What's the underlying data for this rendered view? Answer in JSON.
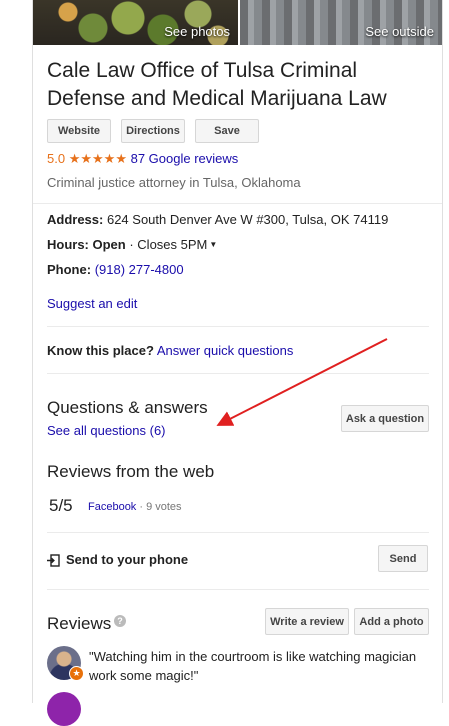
{
  "photos": {
    "left_caption": "See photos",
    "right_caption": "See outside"
  },
  "business": {
    "title": "Cale Law Office of Tulsa Criminal Defense and Medical Marijuana Law",
    "rating": "5.0",
    "stars": "★★★★★",
    "rating_value": 5.0,
    "reviews_link": "87 Google reviews",
    "category": "Criminal justice attorney in Tulsa, Oklahoma"
  },
  "actions": {
    "website": "Website",
    "directions": "Directions",
    "save": "Save"
  },
  "info": {
    "address_label": "Address:",
    "address_value": " 624 South Denver Ave W #300, Tulsa, OK 74119",
    "hours_label": "Hours:",
    "hours_status": " Open",
    "hours_detail": " · Closes 5PM",
    "phone_label": "Phone:",
    "phone_value": "(918) 277-4800"
  },
  "suggest_edit": "Suggest an edit",
  "know": {
    "label": "Know this place?",
    "link": "Answer quick questions"
  },
  "qa": {
    "title": "Questions & answers",
    "link": "See all questions (6)",
    "ask_button": "Ask a question"
  },
  "web_reviews": {
    "title": "Reviews from the web",
    "score": "5/5",
    "source": "Facebook",
    "votes": " · 9 votes"
  },
  "send": {
    "label": "Send to your phone",
    "button": "Send"
  },
  "reviews": {
    "title": "Reviews",
    "help": "?",
    "write_button": "Write a review",
    "add_photo_button": "Add a photo",
    "quote": "\"Watching him in the courtroom is like watching magician work some magic!\""
  },
  "colors": {
    "link": "#1a0dab",
    "star": "#e7711b",
    "arrow": "#e02020"
  },
  "icons": {
    "send": "send-to-phone-icon",
    "help": "help-icon",
    "caret": "caret-down-icon"
  }
}
